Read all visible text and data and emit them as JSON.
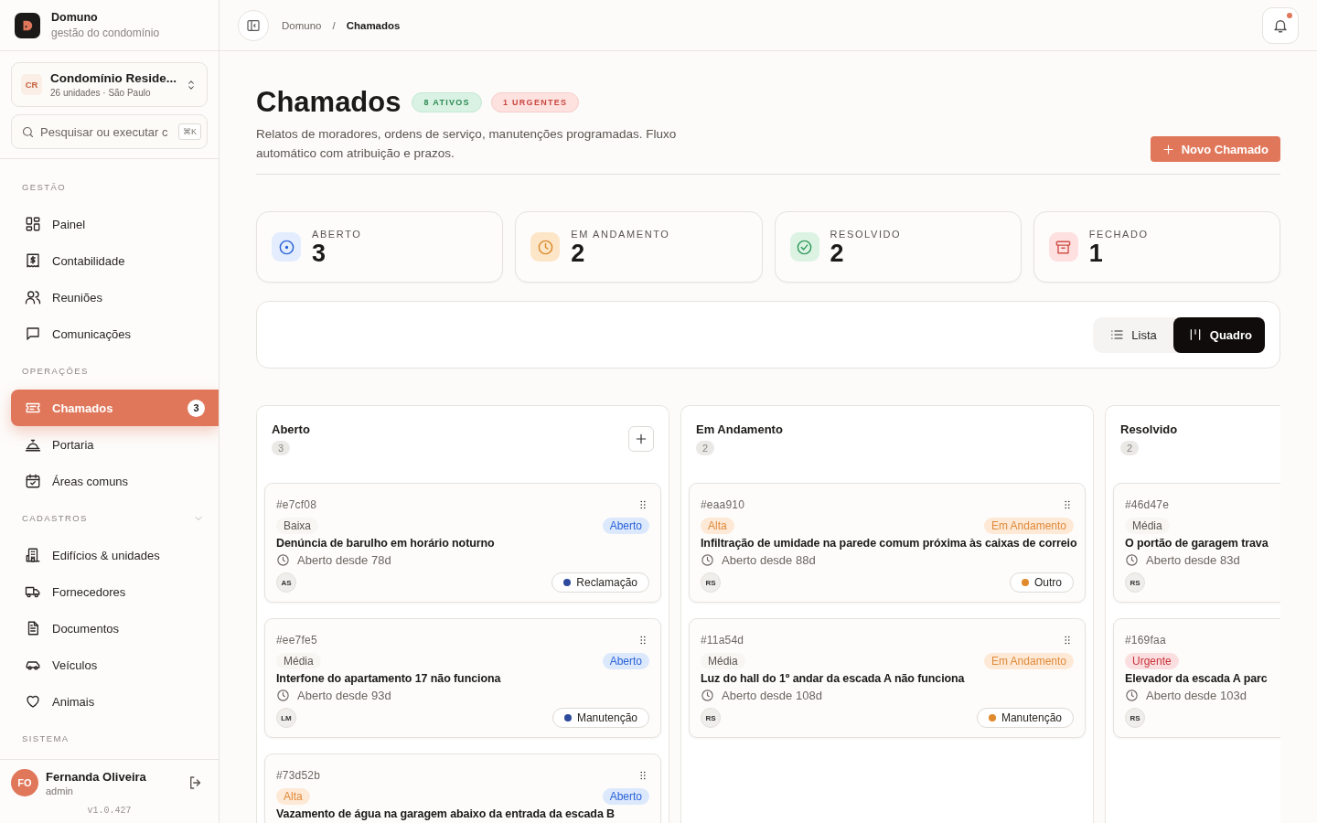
{
  "brand": {
    "name": "Domuno",
    "tagline": "gestão do condomínio"
  },
  "condo": {
    "initials": "CR",
    "name": "Condomínio Reside...",
    "meta": "26 unidades · São Paulo"
  },
  "search": {
    "placeholder": "Pesquisar ou executar c",
    "shortcut": "⌘K"
  },
  "nav_sections": [
    {
      "title": "GESTÃO",
      "kind": "static",
      "items": [
        {
          "label": "Painel",
          "selected": false
        },
        {
          "label": "Contabilidade",
          "selected": false
        },
        {
          "label": "Reuniões",
          "selected": false
        },
        {
          "label": "Comunicações",
          "selected": false
        }
      ]
    },
    {
      "title": "OPERAÇÕES",
      "kind": "static",
      "items": [
        {
          "label": "Chamados",
          "selected": true,
          "badge": "3"
        },
        {
          "label": "Portaria",
          "selected": false
        },
        {
          "label": "Áreas comuns",
          "selected": false
        }
      ]
    },
    {
      "title": "CADASTROS",
      "kind": "collapsible",
      "items": [
        {
          "label": "Edifícios & unidades",
          "selected": false
        },
        {
          "label": "Fornecedores",
          "selected": false
        },
        {
          "label": "Documentos",
          "selected": false
        },
        {
          "label": "Veículos",
          "selected": false
        },
        {
          "label": "Animais",
          "selected": false
        }
      ]
    },
    {
      "title": "SISTEMA",
      "kind": "static"
    }
  ],
  "user": {
    "initials": "FO",
    "name": "Fernanda Oliveira",
    "role": "admin"
  },
  "version": "v1.0.427",
  "breadcrumb": {
    "items": [
      "Domuno",
      "Chamados"
    ],
    "separator": "/"
  },
  "notifications": {
    "unread": true
  },
  "page": {
    "title": "Chamados",
    "badges": [
      {
        "label": "8 ATIVOS",
        "kind": "success"
      },
      {
        "label": "1 URGENTES",
        "kind": "danger"
      }
    ],
    "description": "Relatos de moradores, ordens de serviço, manutenções programadas. Fluxo automático com atribuição e prazos.",
    "primary_button": "Novo Chamado"
  },
  "stats": [
    {
      "label": "ABERTO",
      "value": "3",
      "kind": "open"
    },
    {
      "label": "EM ANDAMENTO",
      "value": "2",
      "kind": "progress"
    },
    {
      "label": "RESOLVIDO",
      "value": "2",
      "kind": "resolved"
    },
    {
      "label": "FECHADO",
      "value": "1",
      "kind": "closed"
    }
  ],
  "view_toggle": [
    {
      "label": "Lista",
      "selected": false
    },
    {
      "label": "Quadro",
      "selected": true
    }
  ],
  "columns": [
    {
      "title": "Aberto",
      "count": "3",
      "has_add": true,
      "cards": [
        {
          "id": "#e7cf08",
          "priority": {
            "label": "Baixa",
            "kind": "low"
          },
          "status": {
            "label": "Aberto",
            "kind": "open"
          },
          "title": "Denúncia de barulho em horário noturno",
          "age": "Aberto desde 78d",
          "assignee": "AS",
          "category": {
            "label": "Reclamação",
            "color": "#2e4a9c"
          }
        },
        {
          "id": "#ee7fe5",
          "priority": {
            "label": "Média",
            "kind": "medium"
          },
          "status": {
            "label": "Aberto",
            "kind": "open"
          },
          "title": "Interfone do apartamento 17 não funciona",
          "age": "Aberto desde 93d",
          "assignee": "LM",
          "category": {
            "label": "Manutenção",
            "color": "#2e4a9c"
          }
        },
        {
          "id": "#73d52b",
          "priority": {
            "label": "Alta",
            "kind": "high"
          },
          "status": {
            "label": "Aberto",
            "kind": "open"
          },
          "title": "Vazamento de água na garagem abaixo da entrada da escada B"
        }
      ]
    },
    {
      "title": "Em Andamento",
      "count": "2",
      "has_add": false,
      "cards": [
        {
          "id": "#eaa910",
          "priority": {
            "label": "Alta",
            "kind": "high"
          },
          "status": {
            "label": "Em Andamento",
            "kind": "progress"
          },
          "title": "Infiltração de umidade na parede comum próxima às caixas de correio",
          "age": "Aberto desde 88d",
          "assignee": "RS",
          "category": {
            "label": "Outro",
            "color": "#e08a2c"
          }
        },
        {
          "id": "#11a54d",
          "priority": {
            "label": "Média",
            "kind": "medium"
          },
          "status": {
            "label": "Em Andamento",
            "kind": "progress"
          },
          "title": "Luz do hall do 1º andar da escada A não funciona",
          "age": "Aberto desde 108d",
          "assignee": "RS",
          "category": {
            "label": "Manutenção",
            "color": "#e08a2c"
          }
        }
      ]
    },
    {
      "title": "Resolvido",
      "count": "2",
      "has_add": false,
      "cards": [
        {
          "id": "#46d47e",
          "priority": {
            "label": "Média",
            "kind": "medium"
          },
          "title": "O portão de garagem trava",
          "age": "Aberto desde 83d",
          "assignee": "RS"
        },
        {
          "id": "#169faa",
          "priority": {
            "label": "Urgente",
            "kind": "urgent"
          },
          "title": "Elevador da escada A parc",
          "age": "Aberto desde 103d",
          "assignee": "RS"
        }
      ]
    }
  ]
}
